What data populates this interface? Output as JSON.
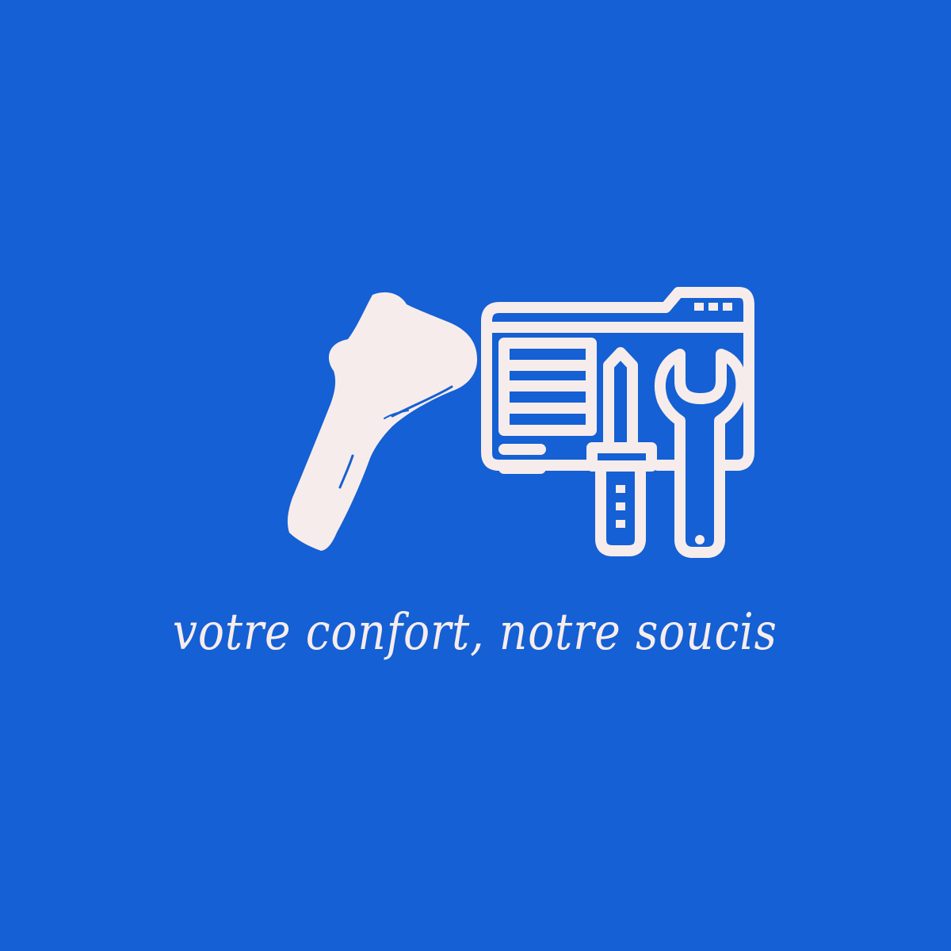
{
  "colors": {
    "background": "#1460d4",
    "foreground": "#f7ecec"
  },
  "icons": {
    "left": "heat-gun-icon",
    "right": "web-maintenance-icon"
  },
  "tagline": "votre confort, notre soucis"
}
